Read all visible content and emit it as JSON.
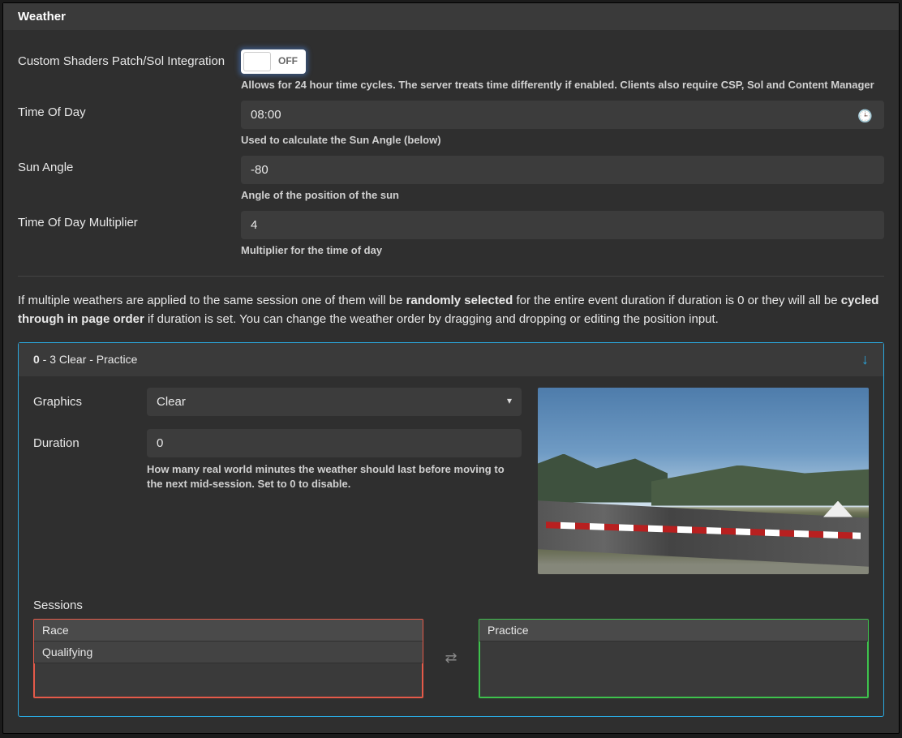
{
  "panel_title": "Weather",
  "csp": {
    "label": "Custom Shaders Patch/Sol Integration",
    "toggle_value": "OFF",
    "hint": "Allows for 24 hour time cycles. The server treats time differently if enabled. Clients also require CSP, Sol and Content Manager"
  },
  "time_of_day": {
    "label": "Time Of Day",
    "value": "08:00",
    "hint": "Used to calculate the Sun Angle (below)"
  },
  "sun_angle": {
    "label": "Sun Angle",
    "value": "-80",
    "hint": "Angle of the position of the sun"
  },
  "tod_multiplier": {
    "label": "Time Of Day Multiplier",
    "value": "4",
    "hint": "Multiplier for the time of day"
  },
  "info": {
    "p1": "If multiple weathers are applied to the same session one of them will be ",
    "b1": "randomly selected",
    "p2": " for the entire event duration if duration is 0 or they will all be ",
    "b2": "cycled through in page order",
    "p3": " if duration is set. You can change the weather order by dragging and dropping or editing the position input."
  },
  "weather_card": {
    "index": "0",
    "title_rest": " - 3 Clear - Practice",
    "graphics_label": "Graphics",
    "graphics_value": "Clear",
    "duration_label": "Duration",
    "duration_value": "0",
    "duration_hint": "How many real world minutes the weather should last before moving to the next mid-session. Set to 0 to disable.",
    "sessions_label": "Sessions",
    "left_sessions": [
      "Race",
      "Qualifying"
    ],
    "right_sessions": [
      "Practice"
    ]
  }
}
